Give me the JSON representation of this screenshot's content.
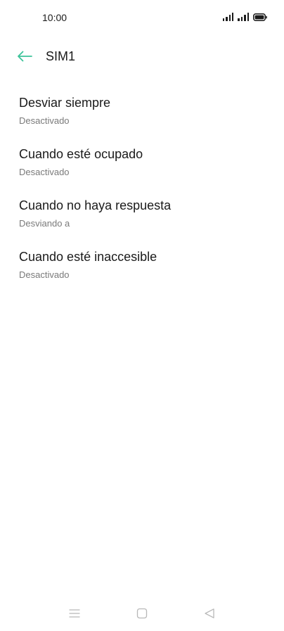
{
  "status_bar": {
    "time": "10:00"
  },
  "header": {
    "title": "SIM1"
  },
  "colors": {
    "accent": "#3cc39a",
    "text_primary": "#1a1a1a",
    "text_secondary": "#7a7a7a",
    "nav_icons": "#b8b8b8"
  },
  "icons": {
    "back": "arrow-left-icon",
    "signal": "signal-icon",
    "battery": "battery-icon",
    "nav_menu": "menu-icon",
    "nav_home": "home-icon",
    "nav_back": "triangle-back-icon"
  },
  "list": {
    "items": [
      {
        "title": "Desviar siempre",
        "subtitle": "Desactivado"
      },
      {
        "title": "Cuando esté ocupado",
        "subtitle": "Desactivado"
      },
      {
        "title": "Cuando no haya respuesta",
        "subtitle": "Desviando a"
      },
      {
        "title": "Cuando esté inaccesible",
        "subtitle": "Desactivado"
      }
    ]
  }
}
